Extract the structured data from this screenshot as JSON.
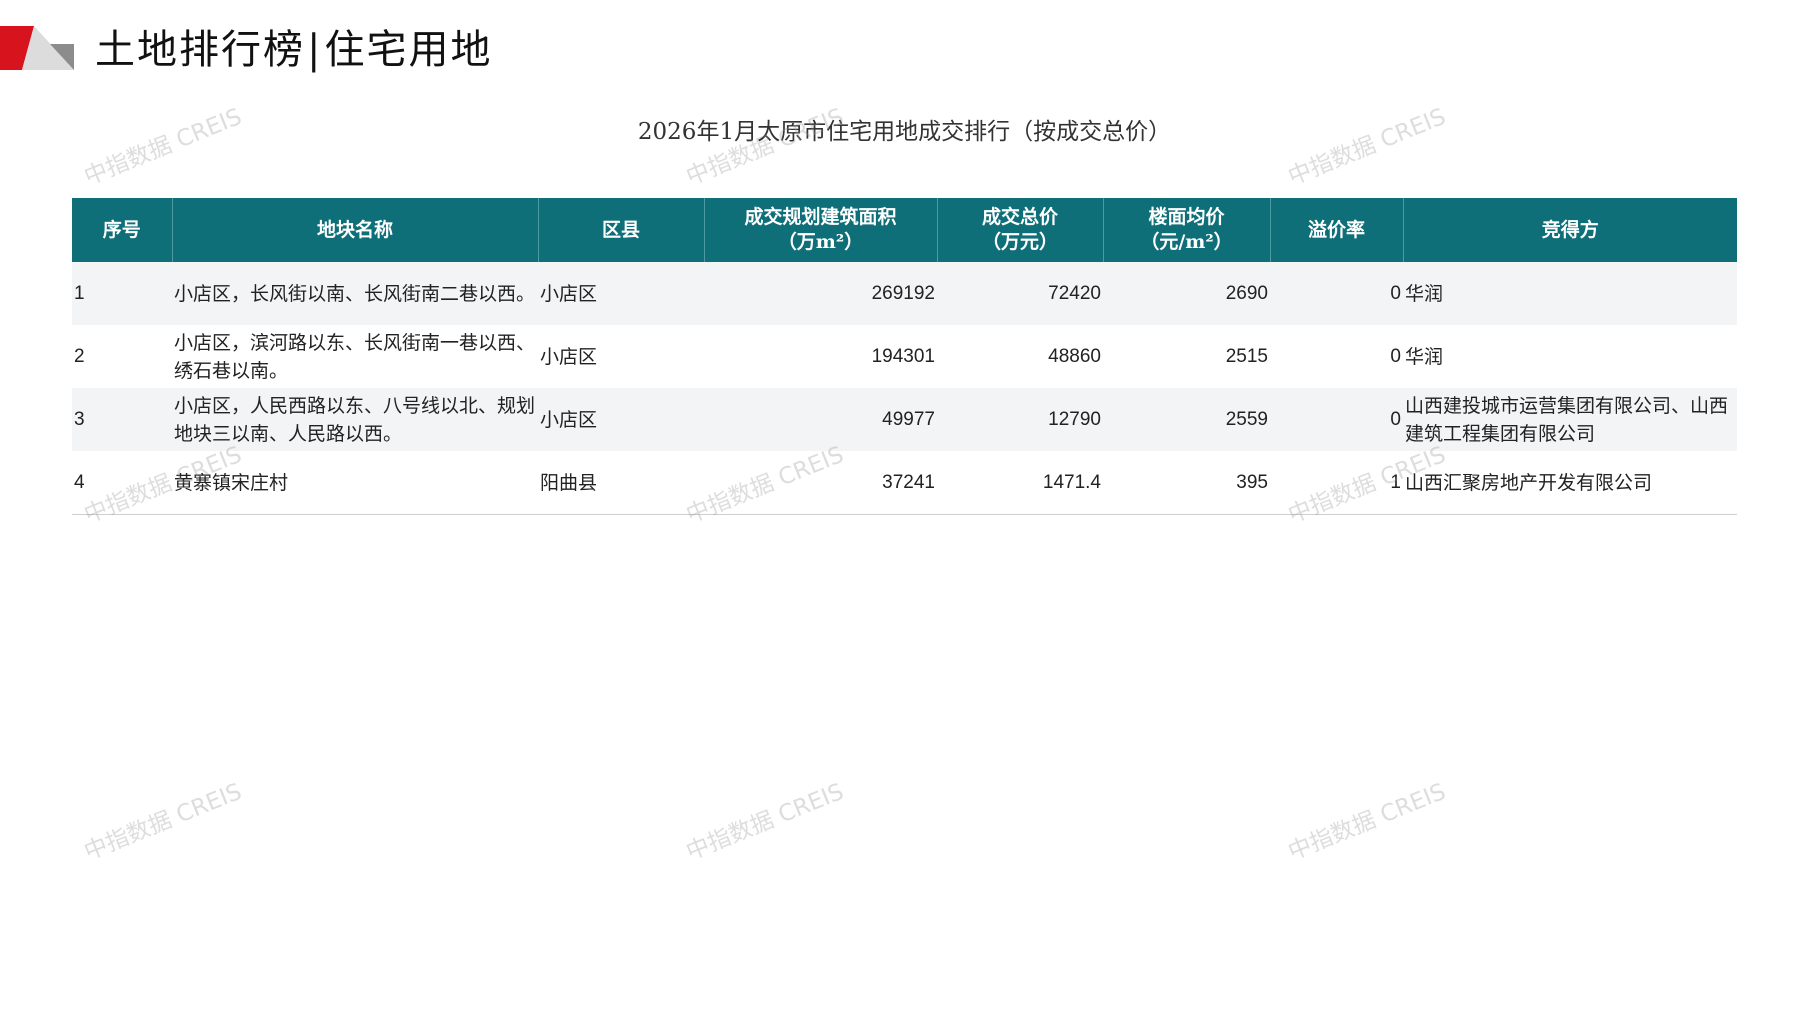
{
  "header": {
    "title_left": "土地排行榜",
    "title_sep": "|",
    "title_right": "住宅用地"
  },
  "table_title": "2026年1月太原市住宅用地成交排行（按成交总价）",
  "columns": [
    {
      "line1": "序号",
      "line2": ""
    },
    {
      "line1": "地块名称",
      "line2": ""
    },
    {
      "line1": "区县",
      "line2": ""
    },
    {
      "line1": "成交规划建筑面积",
      "line2": "（万m²）"
    },
    {
      "line1": "成交总价",
      "line2": "（万元）"
    },
    {
      "line1": "楼面均价",
      "line2": "（元/m²）"
    },
    {
      "line1": "溢价率",
      "line2": ""
    },
    {
      "line1": "竞得方",
      "line2": ""
    }
  ],
  "rows": [
    {
      "idx": "1",
      "name": "小店区，长风街以南、长风街南二巷以西。",
      "district": "小店区",
      "area": "269192",
      "total": "72420",
      "avg": "2690",
      "premium": "0",
      "winner": "华润"
    },
    {
      "idx": "2",
      "name": "小店区，滨河路以东、长风街南一巷以西、绣石巷以南。",
      "district": "小店区",
      "area": "194301",
      "total": "48860",
      "avg": "2515",
      "premium": "0",
      "winner": "华润"
    },
    {
      "idx": "3",
      "name": "小店区，人民西路以东、八号线以北、规划地块三以南、人民路以西。",
      "district": "小店区",
      "area": "49977",
      "total": "12790",
      "avg": "2559",
      "premium": "0",
      "winner": "山西建投城市运营集团有限公司、山西建筑工程集团有限公司"
    },
    {
      "idx": "4",
      "name": "黄寨镇宋庄村",
      "district": "阳曲县",
      "area": "37241",
      "total": "1471.4",
      "avg": "395",
      "premium": "1",
      "winner": "山西汇聚房地产开发有限公司"
    }
  ],
  "watermark": "中指数据 CREIS",
  "colors": {
    "header_bg": "#0f6f78",
    "accent_red": "#c8102e",
    "row_alt_bg": "#f3f4f6"
  }
}
